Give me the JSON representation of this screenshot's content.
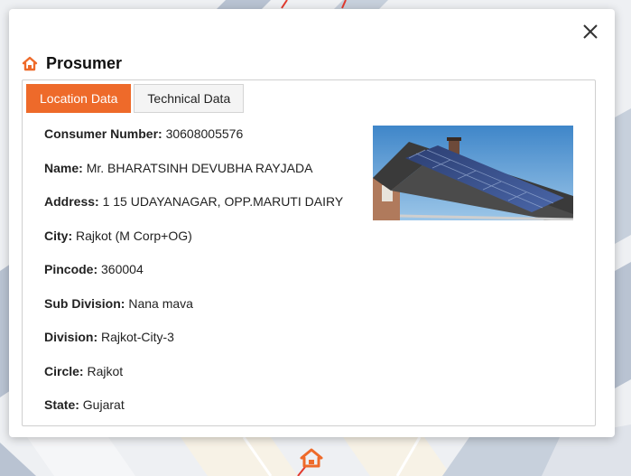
{
  "popup": {
    "title": "Prosumer",
    "tabs": [
      {
        "label": "Location Data",
        "active": true
      },
      {
        "label": "Technical Data",
        "active": false
      }
    ],
    "fields": [
      {
        "label": "Consumer Number:",
        "value": "30608005576"
      },
      {
        "label": "Name:",
        "value": "Mr. BHARATSINH DEVUBHA RAYJADA"
      },
      {
        "label": "Address:",
        "value": "1 15 UDAYANAGAR, OPP.MARUTI DAIRY"
      },
      {
        "label": "City:",
        "value": "Rajkot (M Corp+OG)"
      },
      {
        "label": "Pincode:",
        "value": "360004"
      },
      {
        "label": "Sub Division:",
        "value": "Nana mava"
      },
      {
        "label": "Division:",
        "value": "Rajkot-City-3"
      },
      {
        "label": "Circle:",
        "value": "Rajkot"
      },
      {
        "label": "State:",
        "value": "Gujarat"
      }
    ]
  },
  "colors": {
    "accent": "#ee6a2a",
    "text": "#222222"
  },
  "icons": {
    "close": "close-icon",
    "title": "home-icon",
    "map_marker": "home-marker-icon"
  }
}
